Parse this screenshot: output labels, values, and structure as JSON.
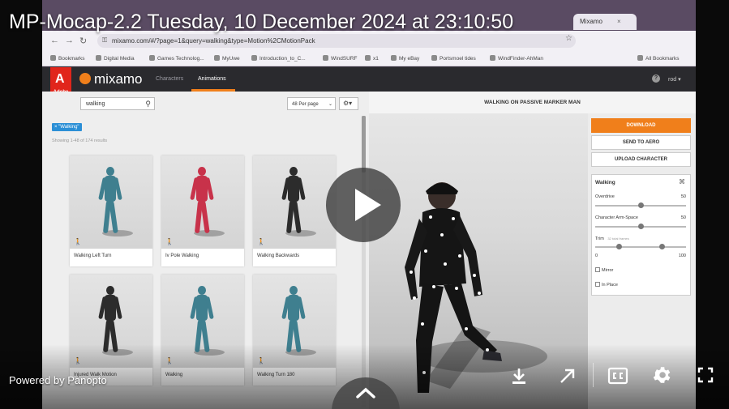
{
  "overlay": {
    "title": "MP-Mocap-2.2 Tuesday, 10 December 2024 at 23:10:50",
    "powered_by": "Powered by Panopto"
  },
  "browser": {
    "tabs": [
      {
        "label": "Mixamo",
        "active": true
      }
    ],
    "url": "mixamo.com/#/?page=1&query=walking&type=Motion%2CMotionPack",
    "bookmarks": [
      "Bookmarks",
      "Digital Media",
      "Games Technolog...",
      "MyUwe",
      "Introduction_to_C...",
      "WindSURF",
      "x1",
      "My eBay",
      "Portsmoel tides",
      "WindFinder-AhMan"
    ],
    "all_bookmarks": "All Bookmarks"
  },
  "mixamo": {
    "brand": "mixamo",
    "adobe_label": "Adobe",
    "nav": [
      {
        "label": "Characters",
        "active": false
      },
      {
        "label": "Animations",
        "active": true
      }
    ],
    "user": "rod",
    "search_value": "walking",
    "per_page": "48 Per page",
    "filter_chip": "× \"Walking\"",
    "results_text": "Showing 1-48 of 174 results",
    "cards": [
      {
        "label": "Walking Left Turn",
        "color": "#3f7f8f"
      },
      {
        "label": "Iv Pole Walking",
        "color": "#c8324a"
      },
      {
        "label": "Walking Backwards",
        "color": "#2c2c2c"
      },
      {
        "label": "Injured Walk Motion",
        "color": "#2c2c2c"
      },
      {
        "label": "Walking",
        "color": "#3f7f8f"
      },
      {
        "label": "Walking Turn 180",
        "color": "#3f7f8f"
      }
    ],
    "viewport_title": "WALKING ON PASSIVE MARKER MAN",
    "buttons": {
      "download": "DOWNLOAD",
      "send_to_aero": "SEND TO AERO",
      "upload_character": "UPLOAD CHARACTER"
    },
    "settings": {
      "title": "Walking",
      "overdrive_label": "Overdrive",
      "overdrive_value": "50",
      "overdrive_level": 0.5,
      "arm_space_label": "Character Arm-Space",
      "arm_space_value": "50",
      "arm_space_level": 0.5,
      "trim_label": "Trim",
      "trim_sub": "32 total frames",
      "trim_min": "0",
      "trim_max": "100",
      "trim_start_level": 0.25,
      "trim_end_level": 0.75,
      "mirror_label": "Mirror",
      "in_place_label": "In Place"
    }
  },
  "icons": {
    "play": "play-icon",
    "download": "download-icon",
    "share": "arrow-up-right-icon",
    "captions": "cc-icon",
    "settings": "gear-icon",
    "fullscreen": "fullscreen-icon",
    "expand": "chevron-up-icon"
  },
  "colors": {
    "mixamo_orange": "#f07f1b",
    "adobe_red": "#e1251b",
    "filter_blue": "#2b8fd6"
  }
}
